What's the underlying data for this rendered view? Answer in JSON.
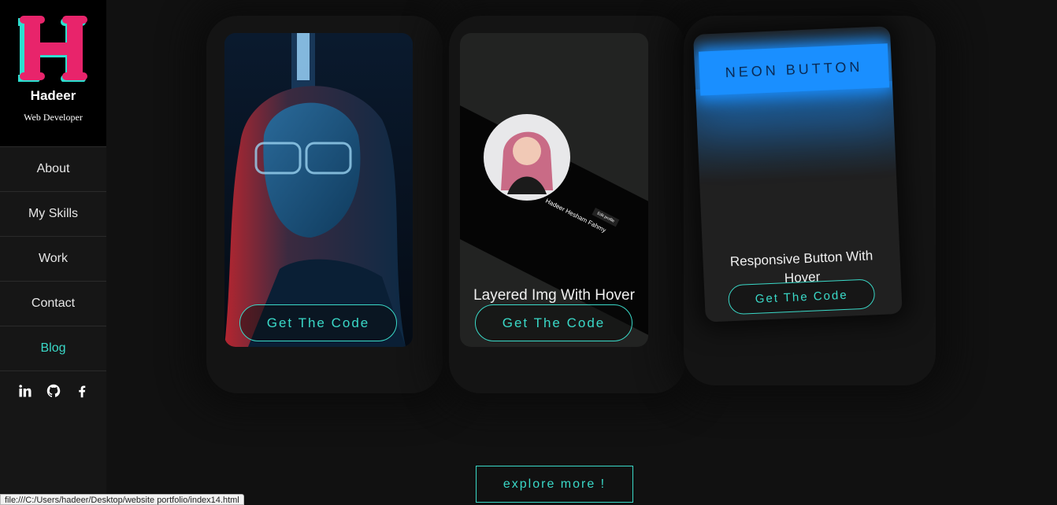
{
  "sidebar": {
    "logo_letter": "H",
    "name": "Hadeer",
    "role": "Web Developer",
    "nav": [
      {
        "label": "About"
      },
      {
        "label": "My Skills"
      },
      {
        "label": "Work"
      },
      {
        "label": "Contact"
      },
      {
        "label": "Blog"
      }
    ],
    "active_nav": "Blog",
    "accent_color": "#3ad9c8",
    "logo_colors": {
      "primary": "#e8246b",
      "shadow": "#2ce0d0"
    },
    "socials": [
      "linkedin-icon",
      "github-icon",
      "facebook-icon"
    ]
  },
  "cards": [
    {
      "title": "",
      "button": "Get The Code"
    },
    {
      "title": "Layered Img With Hover",
      "button": "Get The Code",
      "mock_profile": {
        "name": "Hadeer Hesham Fahmy",
        "btn": "Edit profile"
      }
    },
    {
      "title": "Responsive Button With Hover",
      "button": "Get The Code",
      "neon_label": "NEON BUTTON",
      "neon_color": "#1a8fff"
    }
  ],
  "explore_label": "explore more !",
  "status_url": "file:///C:/Users/hadeer/Desktop/website portfolio/index14.html"
}
